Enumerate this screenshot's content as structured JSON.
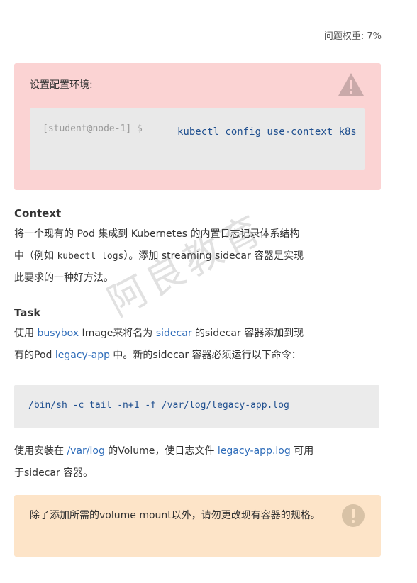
{
  "weight_label": "问题权重: 7%",
  "setup": {
    "title": "设置配置环境:",
    "prompt": "[student@node-1] $",
    "command": "kubectl config use-context k8s"
  },
  "context": {
    "heading": "Context",
    "line1": "将一个现有的 Pod 集成到 Kubernetes 的内置日志记录体系结构",
    "line2_a": "中（例如 ",
    "line2_code": "kubectl logs",
    "line2_b": "）。添加 streaming sidecar 容器是实现",
    "line3": "此要求的一种好方法。"
  },
  "task": {
    "heading": "Task",
    "l1_a": "使用 ",
    "l1_link1": "busybox",
    "l1_b": " Image来将名为 ",
    "l1_link2": "sidecar",
    "l1_c": " 的sidecar 容器添加到现",
    "l2_a": "有的Pod ",
    "l2_link": "legacy-app",
    "l2_b": " 中。新的sidecar 容器必须运行以下命令："
  },
  "code": "/bin/sh -c tail -n+1 -f /var/log/legacy-app.log",
  "volume": {
    "l1_a": "使用安装在 ",
    "l1_link1": "/var/log",
    "l1_b": " 的Volume，使日志文件 ",
    "l1_link2": "legacy-app.log",
    "l1_c": " 可用",
    "l2": "于sidecar 容器。"
  },
  "note": "除了添加所需的volume mount以外，请勿更改现有容器的规格。",
  "watermark": "阿良教育",
  "colors": {
    "link": "#2f6dba",
    "code": "#1f4f8f",
    "warning_bg": "#fbd3d3",
    "note_bg": "#fde4c8"
  }
}
